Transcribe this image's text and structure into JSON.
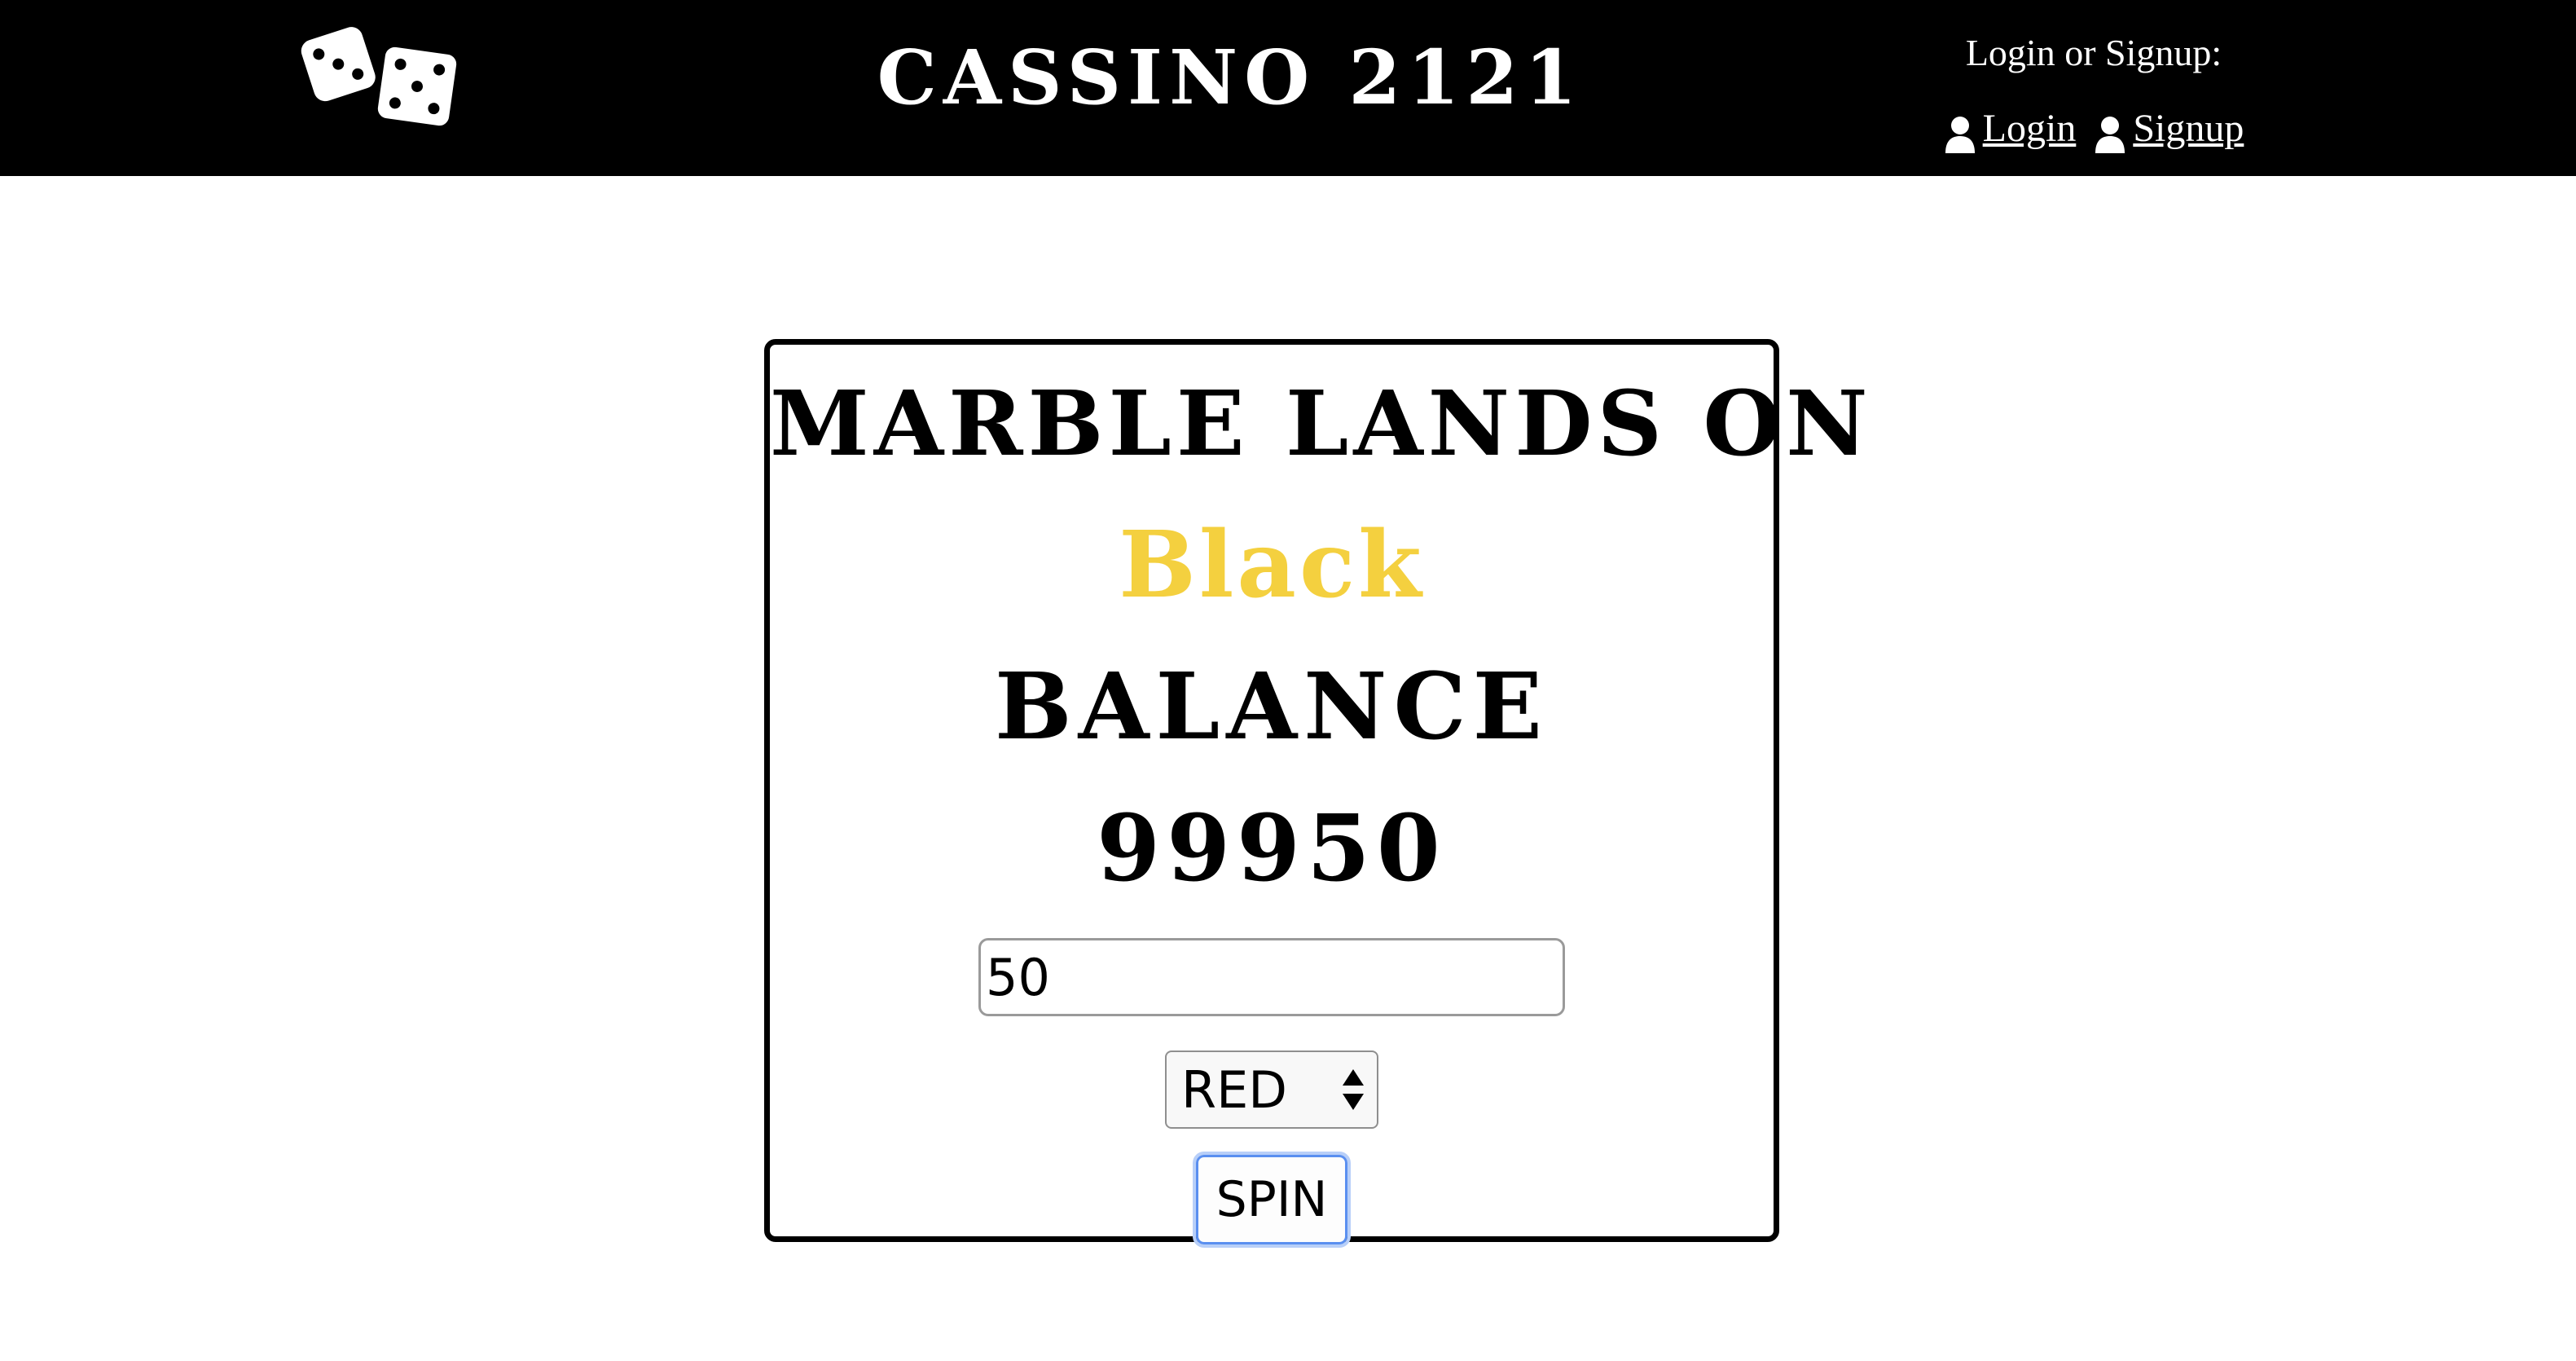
{
  "header": {
    "title": "CASSINO 2121",
    "logo_icon": "dice-icon",
    "auth_prompt": "Login or Signup:",
    "login_label": "Login",
    "signup_label": "Signup",
    "user_icon": "user-icon"
  },
  "game": {
    "result_heading": "MARBLE LANDS ON",
    "result_value": "Black",
    "balance_heading": "BALANCE",
    "balance_value": "99950",
    "bet_value": "50",
    "color_selected": "RED",
    "spin_label": "SPIN"
  },
  "colors": {
    "header_bg": "#000000",
    "result_color": "#f4d03f",
    "focus_ring": "#5a8ff0"
  }
}
